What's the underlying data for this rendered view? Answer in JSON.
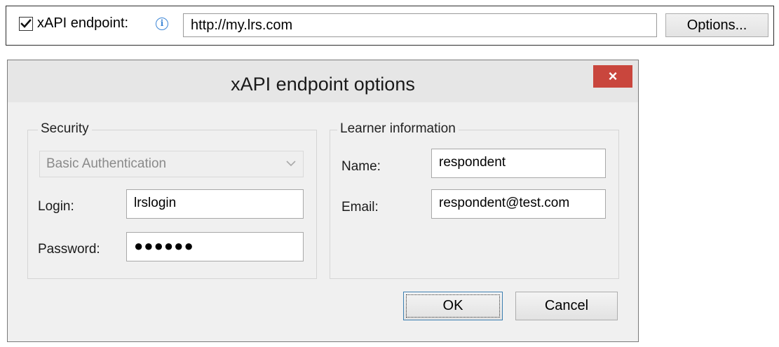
{
  "strip": {
    "checkbox_checked": true,
    "label": "xAPI endpoint:",
    "info_icon": "info-icon",
    "url_value": "http://my.lrs.com",
    "options_label": "Options..."
  },
  "dialog": {
    "title": "xAPI endpoint options",
    "close_glyph": "×",
    "security": {
      "legend": "Security",
      "auth_selected": "Basic Authentication",
      "auth_disabled": true,
      "login_label": "Login:",
      "login_value": "lrslogin",
      "password_label": "Password:",
      "password_mask": "●●●●●●"
    },
    "learner": {
      "legend": "Learner information",
      "name_label": "Name:",
      "name_value": "respondent",
      "email_label": "Email:",
      "email_value": "respondent@test.com"
    },
    "ok_label": "OK",
    "cancel_label": "Cancel"
  },
  "colors": {
    "close_button": "#c9463d",
    "info_icon": "#3d86d6",
    "dialog_bg": "#f0f0f0"
  }
}
